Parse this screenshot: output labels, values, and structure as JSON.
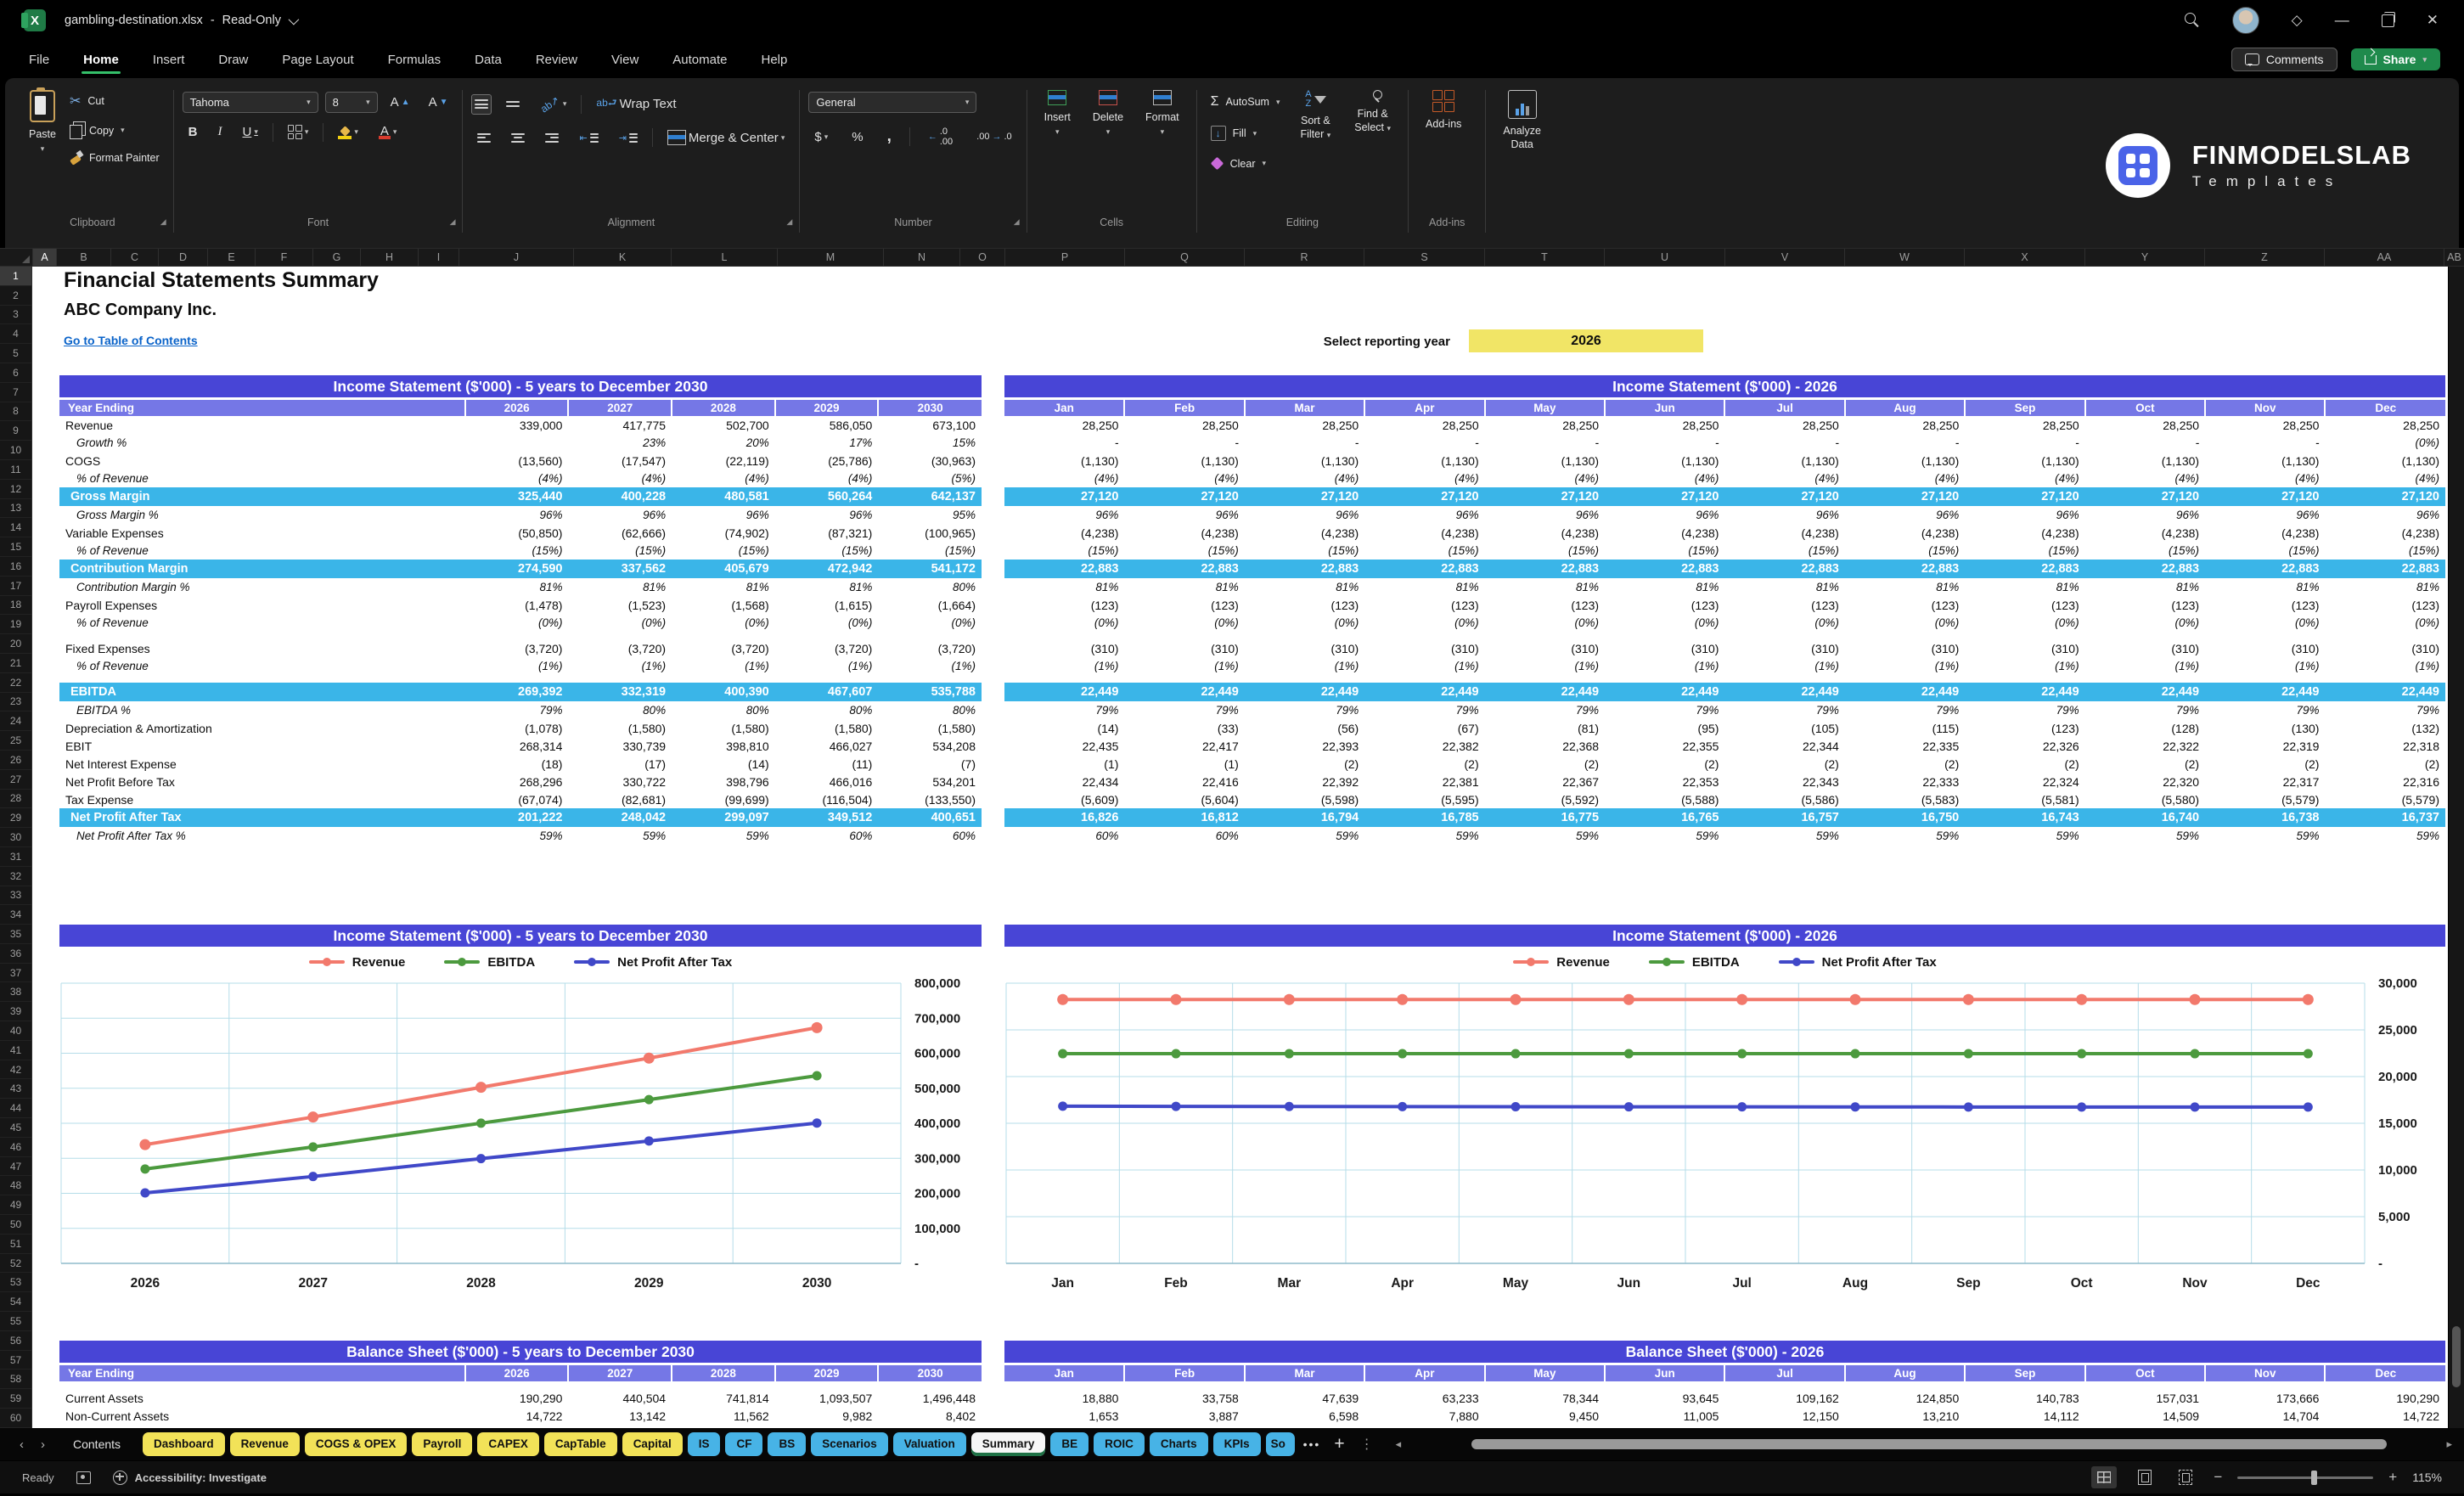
{
  "window": {
    "title": "gambling-destination.xlsx",
    "mode": "Read-Only"
  },
  "menu": {
    "items": [
      "File",
      "Home",
      "Insert",
      "Draw",
      "Page Layout",
      "Formulas",
      "Data",
      "Review",
      "View",
      "Automate",
      "Help"
    ],
    "active": "Home",
    "comments_label": "Comments",
    "share_label": "Share"
  },
  "ribbon": {
    "paste": "Paste",
    "cut": "Cut",
    "copy": "Copy",
    "format_painter": "Format Painter",
    "clipboard_group": "Clipboard",
    "font_name": "Tahoma",
    "font_size": "8",
    "font_group": "Font",
    "wrap_text": "Wrap Text",
    "merge_center": "Merge & Center",
    "alignment_group": "Alignment",
    "number_format": "General",
    "number_group": "Number",
    "insert": "Insert",
    "delete": "Delete",
    "format": "Format",
    "cells_group": "Cells",
    "autosum": "AutoSum",
    "fill": "Fill",
    "clear": "Clear",
    "sort_filter_line1": "Sort &",
    "sort_filter_line2": "Filter",
    "find_select_line1": "Find &",
    "find_select_line2": "Select",
    "editing_group": "Editing",
    "addins": "Add-ins",
    "addins_group": "Add-ins",
    "analyze_line1": "Analyze",
    "analyze_line2": "Data"
  },
  "brand": {
    "name": "FINMODELSLAB",
    "tagline": "Templates"
  },
  "grid": {
    "columns": [
      "A",
      "B",
      "C",
      "D",
      "E",
      "F",
      "G",
      "H",
      "I",
      "J",
      "K",
      "L",
      "M",
      "N",
      "O",
      "P",
      "Q",
      "R",
      "S",
      "T",
      "U",
      "V",
      "W",
      "X",
      "Y",
      "Z",
      "AA",
      "AB"
    ],
    "rows": 60
  },
  "sheet": {
    "title": "Financial Statements Summary",
    "company": "ABC Company Inc.",
    "toc_link": "Go to Table of Contents",
    "select_year_label": "Select reporting year",
    "selected_year": "2026",
    "year_header": "Year Ending",
    "years": [
      "2026",
      "2027",
      "2028",
      "2029",
      "2030"
    ],
    "months": [
      "Jan",
      "Feb",
      "Mar",
      "Apr",
      "May",
      "Jun",
      "Jul",
      "Aug",
      "Sep",
      "Oct",
      "Nov",
      "Dec"
    ],
    "sections": {
      "is_left_title": "Income Statement ($'000) - 5 years to December 2030",
      "is_right_title": "Income Statement ($'000) - 2026",
      "chart_left_title": "Income Statement ($'000) - 5 years to December 2030",
      "chart_right_title": "Income Statement ($'000) - 2026",
      "bs_left_title": "Balance Sheet ($'000) - 5 years to December 2030",
      "bs_right_title": "Balance Sheet ($'000) - 2026"
    },
    "income_rows": [
      {
        "label": "Revenue",
        "type": "data",
        "y": [
          "339,000",
          "417,775",
          "502,700",
          "586,050",
          "673,100"
        ],
        "m": [
          "28,250",
          "28,250",
          "28,250",
          "28,250",
          "28,250",
          "28,250",
          "28,250",
          "28,250",
          "28,250",
          "28,250",
          "28,250",
          "28,250"
        ]
      },
      {
        "label": "Growth %",
        "type": "pct",
        "y": [
          "",
          "23%",
          "20%",
          "17%",
          "15%"
        ],
        "m": [
          "-",
          "-",
          "-",
          "-",
          "-",
          "-",
          "-",
          "-",
          "-",
          "-",
          "-",
          "(0%)"
        ]
      },
      {
        "label": "COGS",
        "type": "data",
        "y": [
          "(13,560)",
          "(17,547)",
          "(22,119)",
          "(25,786)",
          "(30,963)"
        ],
        "m": [
          "(1,130)",
          "(1,130)",
          "(1,130)",
          "(1,130)",
          "(1,130)",
          "(1,130)",
          "(1,130)",
          "(1,130)",
          "(1,130)",
          "(1,130)",
          "(1,130)",
          "(1,130)"
        ]
      },
      {
        "label": "% of Revenue",
        "type": "pct",
        "y": [
          "(4%)",
          "(4%)",
          "(4%)",
          "(4%)",
          "(5%)"
        ],
        "m": [
          "(4%)",
          "(4%)",
          "(4%)",
          "(4%)",
          "(4%)",
          "(4%)",
          "(4%)",
          "(4%)",
          "(4%)",
          "(4%)",
          "(4%)",
          "(4%)"
        ]
      },
      {
        "label": "Gross Margin",
        "type": "total",
        "y": [
          "325,440",
          "400,228",
          "480,581",
          "560,264",
          "642,137"
        ],
        "m": [
          "27,120",
          "27,120",
          "27,120",
          "27,120",
          "27,120",
          "27,120",
          "27,120",
          "27,120",
          "27,120",
          "27,120",
          "27,120",
          "27,120"
        ]
      },
      {
        "label": "Gross Margin %",
        "type": "pct",
        "y": [
          "96%",
          "96%",
          "96%",
          "96%",
          "95%"
        ],
        "m": [
          "96%",
          "96%",
          "96%",
          "96%",
          "96%",
          "96%",
          "96%",
          "96%",
          "96%",
          "96%",
          "96%",
          "96%"
        ]
      },
      {
        "label": "Variable Expenses",
        "type": "data",
        "y": [
          "(50,850)",
          "(62,666)",
          "(74,902)",
          "(87,321)",
          "(100,965)"
        ],
        "m": [
          "(4,238)",
          "(4,238)",
          "(4,238)",
          "(4,238)",
          "(4,238)",
          "(4,238)",
          "(4,238)",
          "(4,238)",
          "(4,238)",
          "(4,238)",
          "(4,238)",
          "(4,238)"
        ]
      },
      {
        "label": "% of Revenue",
        "type": "pct",
        "y": [
          "(15%)",
          "(15%)",
          "(15%)",
          "(15%)",
          "(15%)"
        ],
        "m": [
          "(15%)",
          "(15%)",
          "(15%)",
          "(15%)",
          "(15%)",
          "(15%)",
          "(15%)",
          "(15%)",
          "(15%)",
          "(15%)",
          "(15%)",
          "(15%)"
        ]
      },
      {
        "label": "Contribution Margin",
        "type": "total",
        "y": [
          "274,590",
          "337,562",
          "405,679",
          "472,942",
          "541,172"
        ],
        "m": [
          "22,883",
          "22,883",
          "22,883",
          "22,883",
          "22,883",
          "22,883",
          "22,883",
          "22,883",
          "22,883",
          "22,883",
          "22,883",
          "22,883"
        ]
      },
      {
        "label": "Contribution Margin %",
        "type": "pct",
        "y": [
          "81%",
          "81%",
          "81%",
          "81%",
          "80%"
        ],
        "m": [
          "81%",
          "81%",
          "81%",
          "81%",
          "81%",
          "81%",
          "81%",
          "81%",
          "81%",
          "81%",
          "81%",
          "81%"
        ]
      },
      {
        "label": "Payroll Expenses",
        "type": "data",
        "y": [
          "(1,478)",
          "(1,523)",
          "(1,568)",
          "(1,615)",
          "(1,664)"
        ],
        "m": [
          "(123)",
          "(123)",
          "(123)",
          "(123)",
          "(123)",
          "(123)",
          "(123)",
          "(123)",
          "(123)",
          "(123)",
          "(123)",
          "(123)"
        ]
      },
      {
        "label": "% of Revenue",
        "type": "pct",
        "y": [
          "(0%)",
          "(0%)",
          "(0%)",
          "(0%)",
          "(0%)"
        ],
        "m": [
          "(0%)",
          "(0%)",
          "(0%)",
          "(0%)",
          "(0%)",
          "(0%)",
          "(0%)",
          "(0%)",
          "(0%)",
          "(0%)",
          "(0%)",
          "(0%)"
        ]
      },
      {
        "label": "",
        "type": "spacer",
        "y": [],
        "m": []
      },
      {
        "label": "Fixed Expenses",
        "type": "data",
        "y": [
          "(3,720)",
          "(3,720)",
          "(3,720)",
          "(3,720)",
          "(3,720)"
        ],
        "m": [
          "(310)",
          "(310)",
          "(310)",
          "(310)",
          "(310)",
          "(310)",
          "(310)",
          "(310)",
          "(310)",
          "(310)",
          "(310)",
          "(310)"
        ]
      },
      {
        "label": "% of Revenue",
        "type": "pct",
        "y": [
          "(1%)",
          "(1%)",
          "(1%)",
          "(1%)",
          "(1%)"
        ],
        "m": [
          "(1%)",
          "(1%)",
          "(1%)",
          "(1%)",
          "(1%)",
          "(1%)",
          "(1%)",
          "(1%)",
          "(1%)",
          "(1%)",
          "(1%)",
          "(1%)"
        ]
      },
      {
        "label": "",
        "type": "spacer",
        "y": [],
        "m": []
      },
      {
        "label": "EBITDA",
        "type": "total",
        "y": [
          "269,392",
          "332,319",
          "400,390",
          "467,607",
          "535,788"
        ],
        "m": [
          "22,449",
          "22,449",
          "22,449",
          "22,449",
          "22,449",
          "22,449",
          "22,449",
          "22,449",
          "22,449",
          "22,449",
          "22,449",
          "22,449"
        ]
      },
      {
        "label": "EBITDA %",
        "type": "pct",
        "y": [
          "79%",
          "80%",
          "80%",
          "80%",
          "80%"
        ],
        "m": [
          "79%",
          "79%",
          "79%",
          "79%",
          "79%",
          "79%",
          "79%",
          "79%",
          "79%",
          "79%",
          "79%",
          "79%"
        ]
      },
      {
        "label": "Depreciation & Amortization",
        "type": "data",
        "y": [
          "(1,078)",
          "(1,580)",
          "(1,580)",
          "(1,580)",
          "(1,580)"
        ],
        "m": [
          "(14)",
          "(33)",
          "(56)",
          "(67)",
          "(81)",
          "(95)",
          "(105)",
          "(115)",
          "(123)",
          "(128)",
          "(130)",
          "(132)"
        ]
      },
      {
        "label": "EBIT",
        "type": "data",
        "y": [
          "268,314",
          "330,739",
          "398,810",
          "466,027",
          "534,208"
        ],
        "m": [
          "22,435",
          "22,417",
          "22,393",
          "22,382",
          "22,368",
          "22,355",
          "22,344",
          "22,335",
          "22,326",
          "22,322",
          "22,319",
          "22,318"
        ]
      },
      {
        "label": "Net Interest Expense",
        "type": "data",
        "y": [
          "(18)",
          "(17)",
          "(14)",
          "(11)",
          "(7)"
        ],
        "m": [
          "(1)",
          "(1)",
          "(2)",
          "(2)",
          "(2)",
          "(2)",
          "(2)",
          "(2)",
          "(2)",
          "(2)",
          "(2)",
          "(2)"
        ]
      },
      {
        "label": "Net Profit Before Tax",
        "type": "data",
        "y": [
          "268,296",
          "330,722",
          "398,796",
          "466,016",
          "534,201"
        ],
        "m": [
          "22,434",
          "22,416",
          "22,392",
          "22,381",
          "22,367",
          "22,353",
          "22,343",
          "22,333",
          "22,324",
          "22,320",
          "22,317",
          "22,316"
        ]
      },
      {
        "label": "Tax Expense",
        "type": "data",
        "y": [
          "(67,074)",
          "(82,681)",
          "(99,699)",
          "(116,504)",
          "(133,550)"
        ],
        "m": [
          "(5,609)",
          "(5,604)",
          "(5,598)",
          "(5,595)",
          "(5,592)",
          "(5,588)",
          "(5,586)",
          "(5,583)",
          "(5,581)",
          "(5,580)",
          "(5,579)",
          "(5,579)"
        ]
      },
      {
        "label": "Net Profit After Tax",
        "type": "total",
        "y": [
          "201,222",
          "248,042",
          "299,097",
          "349,512",
          "400,651"
        ],
        "m": [
          "16,826",
          "16,812",
          "16,794",
          "16,785",
          "16,775",
          "16,765",
          "16,757",
          "16,750",
          "16,743",
          "16,740",
          "16,738",
          "16,737"
        ]
      },
      {
        "label": "Net Profit After Tax %",
        "type": "pct",
        "y": [
          "59%",
          "59%",
          "59%",
          "60%",
          "60%"
        ],
        "m": [
          "60%",
          "60%",
          "59%",
          "59%",
          "59%",
          "59%",
          "59%",
          "59%",
          "59%",
          "59%",
          "59%",
          "59%"
        ]
      }
    ],
    "balance_rows": [
      {
        "label": "",
        "type": "spacer",
        "y": [],
        "m": []
      },
      {
        "label": "Current Assets",
        "type": "data",
        "y": [
          "190,290",
          "440,504",
          "741,814",
          "1,093,507",
          "1,496,448"
        ],
        "m": [
          "18,880",
          "33,758",
          "47,639",
          "63,233",
          "78,344",
          "93,645",
          "109,162",
          "124,850",
          "140,783",
          "157,031",
          "173,666",
          "190,290"
        ]
      },
      {
        "label": "Non-Current Assets",
        "type": "data",
        "y": [
          "14,722",
          "13,142",
          "11,562",
          "9,982",
          "8,402"
        ],
        "m": [
          "1,653",
          "3,887",
          "6,598",
          "7,880",
          "9,450",
          "11,005",
          "12,150",
          "13,210",
          "14,112",
          "14,509",
          "14,704",
          "14,722"
        ]
      }
    ]
  },
  "chart_data": [
    {
      "type": "line",
      "title": "Income Statement ($'000) - 5 years to December 2030",
      "x": [
        "2026",
        "2027",
        "2028",
        "2029",
        "2030"
      ],
      "series": [
        {
          "name": "Revenue",
          "color": "#F2796C",
          "values": [
            339000,
            417775,
            502700,
            586050,
            673100
          ]
        },
        {
          "name": "EBITDA",
          "color": "#4C9A3E",
          "values": [
            269392,
            332319,
            400390,
            467607,
            535788
          ]
        },
        {
          "name": "Net Profit After Tax",
          "color": "#4048C8",
          "values": [
            201222,
            248042,
            299097,
            349512,
            400651
          ]
        }
      ],
      "ylim": [
        0,
        800000
      ],
      "ytick": 100000,
      "legend_position": "top",
      "y_axis_side": "right",
      "grid": true
    },
    {
      "type": "line",
      "title": "Income Statement ($'000) - 2026",
      "x": [
        "Jan",
        "Feb",
        "Mar",
        "Apr",
        "May",
        "Jun",
        "Jul",
        "Aug",
        "Sep",
        "Oct",
        "Nov",
        "Dec"
      ],
      "series": [
        {
          "name": "Revenue",
          "color": "#F2796C",
          "values": [
            28250,
            28250,
            28250,
            28250,
            28250,
            28250,
            28250,
            28250,
            28250,
            28250,
            28250,
            28250
          ]
        },
        {
          "name": "EBITDA",
          "color": "#4C9A3E",
          "values": [
            22449,
            22449,
            22449,
            22449,
            22449,
            22449,
            22449,
            22449,
            22449,
            22449,
            22449,
            22449
          ]
        },
        {
          "name": "Net Profit After Tax",
          "color": "#4048C8",
          "values": [
            16826,
            16812,
            16794,
            16785,
            16775,
            16765,
            16757,
            16750,
            16743,
            16740,
            16738,
            16737
          ]
        }
      ],
      "ylim": [
        0,
        30000
      ],
      "ytick": 5000,
      "legend_position": "top",
      "y_axis_side": "right",
      "grid": true
    }
  ],
  "tabs": {
    "sheets": [
      {
        "label": "Contents",
        "style": "plain"
      },
      {
        "label": "Dashboard",
        "style": "yellow"
      },
      {
        "label": "Revenue",
        "style": "yellow"
      },
      {
        "label": "COGS & OPEX",
        "style": "yellow"
      },
      {
        "label": "Payroll",
        "style": "yellow"
      },
      {
        "label": "CAPEX",
        "style": "yellow"
      },
      {
        "label": "CapTable",
        "style": "yellow"
      },
      {
        "label": "Capital",
        "style": "yellow"
      },
      {
        "label": "IS",
        "style": "blue"
      },
      {
        "label": "CF",
        "style": "blue"
      },
      {
        "label": "BS",
        "style": "blue"
      },
      {
        "label": "Scenarios",
        "style": "blue"
      },
      {
        "label": "Valuation",
        "style": "blue"
      },
      {
        "label": "Summary",
        "style": "active"
      },
      {
        "label": "BE",
        "style": "blue"
      },
      {
        "label": "ROIC",
        "style": "blue"
      },
      {
        "label": "Charts",
        "style": "blue"
      },
      {
        "label": "KPIs",
        "style": "blue"
      },
      {
        "label": "So",
        "style": "blue cut"
      }
    ]
  },
  "status": {
    "ready": "Ready",
    "accessibility": "Accessibility: Investigate",
    "zoom": "115%"
  },
  "colors": {
    "section_header_blue": "#4845d6",
    "column_header_purple": "#7577e6",
    "total_row_cyan": "#3ab5e8",
    "input_yellow": "#f1e566",
    "tab_yellow": "#f2e258",
    "tab_blue": "#47b3e6",
    "share_green": "#1f8a4c",
    "excel_green": "#1f7b46",
    "link_blue": "#0a63c9",
    "chart_grid": "#b5dde9"
  }
}
